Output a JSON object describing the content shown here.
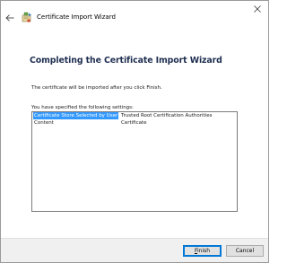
{
  "window": {
    "title": "Certificate Import Wizard"
  },
  "icons": {
    "back": "back-arrow-icon",
    "wizard": "certificate-wizard-icon",
    "close": "close-icon"
  },
  "page": {
    "heading": "Completing the Certificate Import Wizard",
    "info": "The certificate will be imported after you click Finish.",
    "settings_label": "You have specified the following settings:"
  },
  "settings": {
    "rows": [
      {
        "name": "Certificate Store Selected by User",
        "value": "Trusted Root Certification Authorities",
        "selected": true
      },
      {
        "name": "Content",
        "value": "Certificate",
        "selected": false
      }
    ]
  },
  "buttons": {
    "finish": "Finish",
    "cancel": "Cancel"
  },
  "colors": {
    "heading": "#1e2e50",
    "selection": "#3399ff",
    "default_button_border": "#0078d7"
  }
}
